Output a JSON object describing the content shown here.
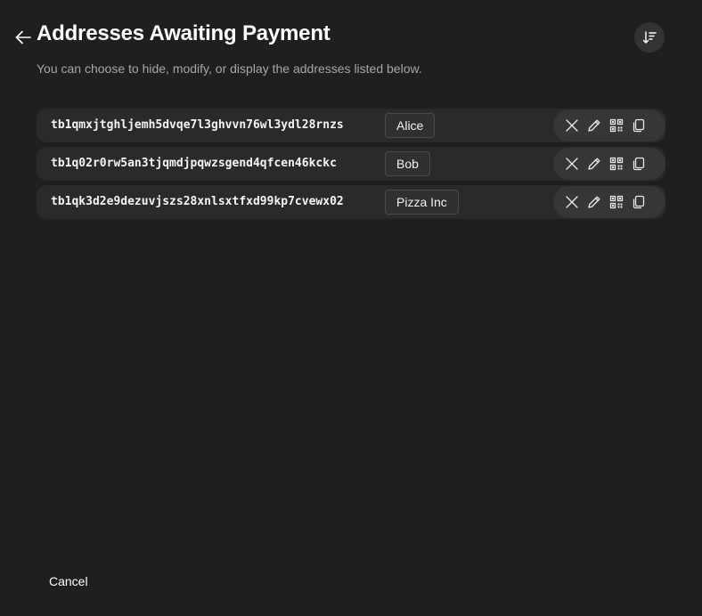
{
  "header": {
    "title": "Addresses Awaiting Payment",
    "subtitle": "You can choose to hide, modify, or display the addresses listed below."
  },
  "icons": {
    "back": "arrow-left-icon",
    "sort": "sort-descending-icon",
    "hide": "close-icon",
    "edit": "pencil-icon",
    "qr": "qr-code-icon",
    "copy": "copy-icon"
  },
  "addresses": [
    {
      "address": "tb1qmxjtghljemh5dvqe7l3ghvvn76wl3ydl28rnzs",
      "label": "Alice"
    },
    {
      "address": "tb1q02r0rw5an3tjqmdjpqwzsgend4qfcen46kckc",
      "label": "Bob"
    },
    {
      "address": "tb1qk3d2e9dezuvjszs28xnlsxtfxd99kp7cvewx02",
      "label": "Pizza Inc"
    }
  ],
  "footer": {
    "cancel_label": "Cancel"
  },
  "colors": {
    "background": "#1f1f1f",
    "row": "#2a2a2a",
    "actions": "#363636",
    "subtitle": "#a6a6a6"
  }
}
